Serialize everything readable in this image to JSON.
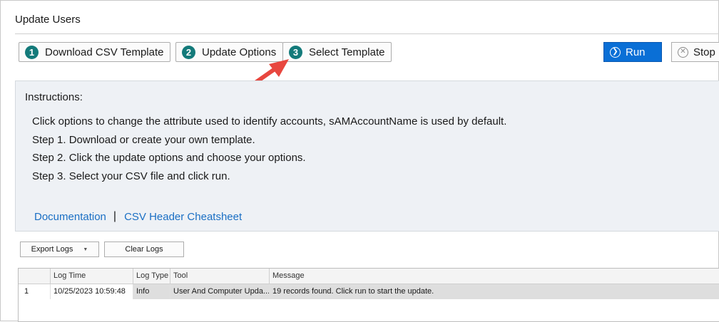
{
  "window": {
    "title": "Update Users"
  },
  "toolbar": {
    "steps": [
      {
        "num": "1",
        "label": "Download CSV Template"
      },
      {
        "num": "2",
        "label": "Update Options"
      },
      {
        "num": "3",
        "label": "Select Template"
      }
    ],
    "run_label": "Run",
    "stop_label": "Stop"
  },
  "instructions": {
    "heading": "Instructions:",
    "lines": [
      "Click options to change the attribute used to identify accounts, sAMAccountName is used by default.",
      "Step 1. Download or create your own template.",
      "Step 2. Click the update options and choose your options.",
      "Step 3. Select your CSV file and click run."
    ],
    "links": {
      "documentation": "Documentation",
      "separator": "|",
      "cheatsheet": "CSV Header Cheatsheet"
    }
  },
  "logs": {
    "export_label": "Export Logs",
    "clear_label": "Clear Logs",
    "columns": [
      "Log Time",
      "Log Type",
      "Tool",
      "Message"
    ],
    "rows": [
      {
        "index": "1",
        "time": "10/25/2023 10:59:48",
        "type": "Info",
        "tool": "User And Computer Upda...",
        "message": "19 records found. Click run to start the update."
      }
    ]
  },
  "colors": {
    "accent": "#0a6fd6",
    "step_badge": "#137a7a",
    "link": "#1a6fc4",
    "annotation_arrow": "#e8473f"
  },
  "icons": {
    "run": "run-circle-chevron-icon",
    "stop": "stop-circle-x-icon",
    "dropdown": "caret-down-icon",
    "annotation": "red-arrow-icon"
  }
}
